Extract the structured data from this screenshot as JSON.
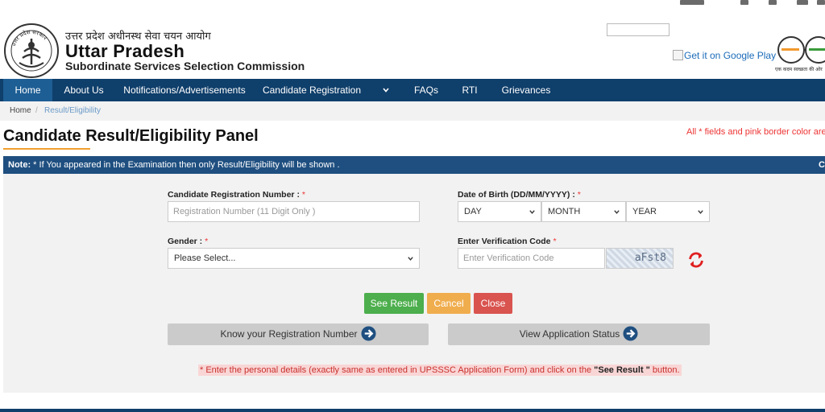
{
  "header": {
    "hindi_title": "उत्तर प्रदेश अधीनस्थ सेवा चयन आयोग",
    "brand": "Uttar Pradesh",
    "subbrand": "Subordinate Services Selection Commission",
    "emblem_text": "उत्तर प्रदेश सरकार",
    "google_play_text": "Get it on Google Play",
    "swachh_text": "एक कदम स्वच्छता की ओर"
  },
  "nav": {
    "items": [
      "Home",
      "About Us",
      "Notifications/Advertisements",
      "Candidate Registration",
      "FAQs",
      "RTI",
      "Grievances"
    ]
  },
  "breadcrumb": {
    "home": "Home",
    "separator": "/",
    "current": "Result/Eligibility"
  },
  "page": {
    "title": "Candidate Result/Eligibility Panel",
    "required_note": "All * fields and pink border color are"
  },
  "note": {
    "label": "Note:",
    "text": "* If You appeared in the Examination then only Result/Eligibility will be shown .",
    "right_glyph": "C"
  },
  "form": {
    "reg_label": "Candidate Registration Number :",
    "reg_placeholder": "Registration Number (11 Digit Only )",
    "dob_label": "Date of Birth (DD/MM/YYYY) :",
    "day": "DAY",
    "month": "MONTH",
    "year": "YEAR",
    "gender_label": "Gender :",
    "gender_value": "Please Select...",
    "code_label": "Enter Verification Code",
    "code_placeholder": "Enter Verification Code",
    "captcha": "aFst8",
    "star": "*"
  },
  "buttons": {
    "see_result": "See Result",
    "cancel": "Cancel",
    "close": "Close",
    "know_reg": "Know your Registration Number",
    "view_status": "View Application Status"
  },
  "footnote": {
    "prefix": "* Enter the personal details (exactly same as entered in UPSSSC Application Form) and click on the ",
    "bold": "\"See Result \"",
    "suffix": " button."
  },
  "colors": {
    "nav_bg": "#0f3f6b",
    "note_bg": "#1f4f80",
    "green": "#4cae4c",
    "orange": "#f0ad4e",
    "red": "#d9534f"
  }
}
